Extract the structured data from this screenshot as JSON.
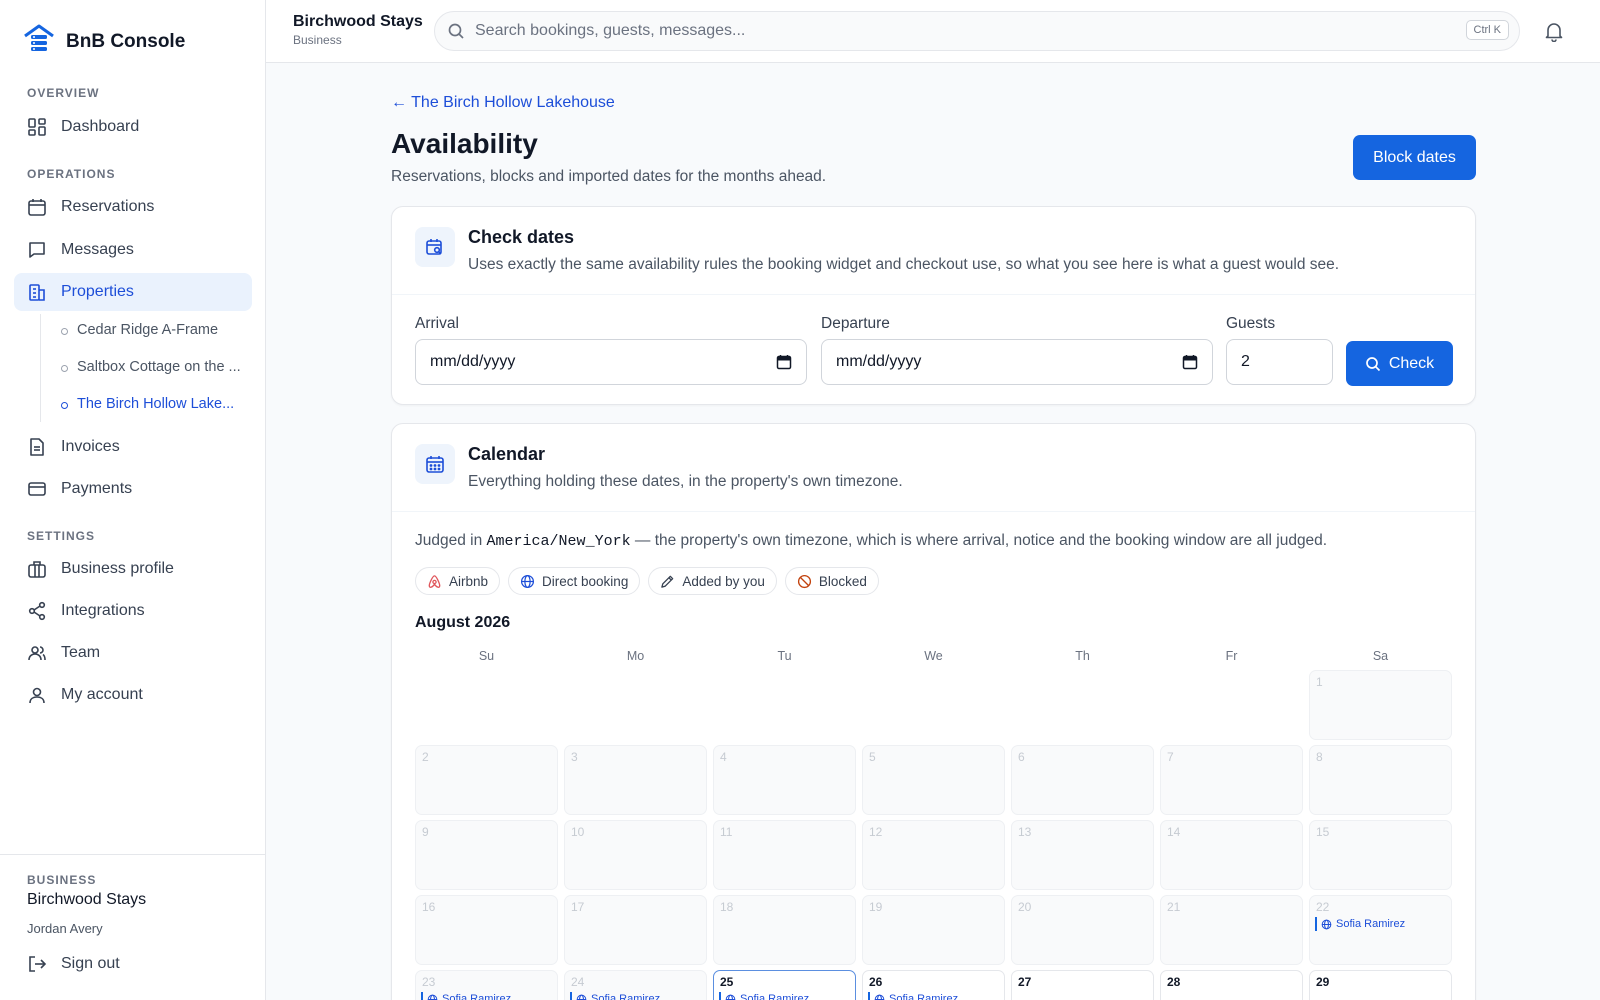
{
  "app": {
    "brand": "BnB Console"
  },
  "sidebar": {
    "overview_title": "OVERVIEW",
    "operations_title": "OPERATIONS",
    "settings_title": "SETTINGS",
    "items": {
      "dashboard": "Dashboard",
      "reservations": "Reservations",
      "messages": "Messages",
      "properties": "Properties",
      "invoices": "Invoices",
      "payments": "Payments",
      "business_profile": "Business profile",
      "integrations": "Integrations",
      "team": "Team",
      "my_account": "My account"
    },
    "properties": [
      {
        "label": "Cedar Ridge A-Frame"
      },
      {
        "label": "Saltbox Cottage on the ..."
      },
      {
        "label": "The Birch Hollow Lake..."
      }
    ],
    "footer": {
      "label": "BUSINESS",
      "business": "Birchwood Stays",
      "user": "Jordan Avery",
      "sign_out": "Sign out"
    }
  },
  "topbar": {
    "title": "Birchwood Stays",
    "subtitle": "Business",
    "search_placeholder": "Search bookings, guests, messages...",
    "shortcut": "Ctrl K"
  },
  "page": {
    "back_link": "← The Birch Hollow Lakehouse",
    "title": "Availability",
    "description": "Reservations, blocks and imported dates for the months ahead.",
    "block_button": "Block dates"
  },
  "check_dates": {
    "title": "Check dates",
    "description": "Uses exactly the same availability rules the booking widget and checkout use, so what you see here is what a guest would see.",
    "arrival_label": "Arrival",
    "arrival_value": "mm/dd/yyyy",
    "departure_label": "Departure",
    "departure_value": "mm/dd/yyyy",
    "guests_label": "Guests",
    "guests_value": "2",
    "check_button": "Check"
  },
  "calendar": {
    "title": "Calendar",
    "description": "Everything holding these dates, in the property's own timezone.",
    "tz_prefix": "Judged in",
    "timezone": "America/New_York",
    "tz_suffix": "— the property's own timezone, which is where arrival, notice and the booking window are all judged.",
    "legend": {
      "airbnb": "Airbnb",
      "direct": "Direct booking",
      "added": "Added by you",
      "blocked": "Blocked"
    },
    "month": "August 2026",
    "weekdays": [
      "Su",
      "Mo",
      "Tu",
      "We",
      "Th",
      "Fr",
      "Sa"
    ],
    "booking_guest": "Sofia Ramirez",
    "colors": {
      "accent": "#1565e0",
      "airbnb": "#e0565b",
      "blocked": "#c2410c"
    }
  }
}
